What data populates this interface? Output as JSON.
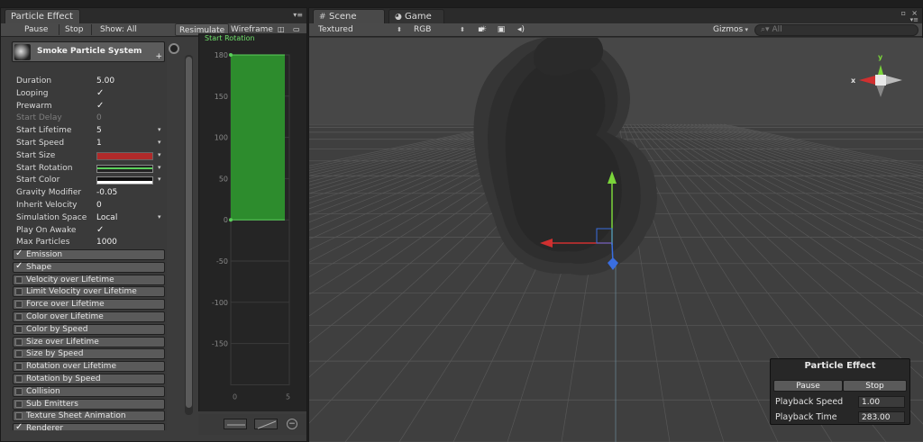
{
  "particle_window": {
    "tab": "Particle Effect",
    "toolbar": {
      "pause": "Pause",
      "stop": "Stop",
      "show": "Show: All",
      "resimulate": "Resimulate",
      "wireframe": "Wireframe"
    }
  },
  "inspector": {
    "system_name": "Smoke Particle System",
    "plus": "+",
    "props": [
      {
        "label": "Duration",
        "value": "5.00"
      },
      {
        "label": "Looping",
        "check": "✓"
      },
      {
        "label": "Prewarm",
        "check": "✓"
      },
      {
        "label": "Start Delay",
        "value": "0"
      },
      {
        "label": "Start Lifetime",
        "value": "5"
      },
      {
        "label": "Start Speed",
        "value": "1"
      },
      {
        "label": "Start Size"
      },
      {
        "label": "Start Rotation"
      },
      {
        "label": "Start Color"
      },
      {
        "label": "Gravity Modifier",
        "value": "-0.05"
      },
      {
        "label": "Inherit Velocity",
        "value": "0"
      },
      {
        "label": "Simulation Space",
        "value": "Local"
      },
      {
        "label": "Play On Awake",
        "check": "✓"
      },
      {
        "label": "Max Particles",
        "value": "1000"
      }
    ],
    "modules": [
      {
        "label": "Emission",
        "enabled": "✓"
      },
      {
        "label": "Shape",
        "enabled": "✓"
      },
      {
        "label": "Velocity over Lifetime"
      },
      {
        "label": "Limit Velocity over Lifetime"
      },
      {
        "label": "Force over Lifetime"
      },
      {
        "label": "Color over Lifetime"
      },
      {
        "label": "Color by Speed"
      },
      {
        "label": "Size over Lifetime"
      },
      {
        "label": "Size by Speed"
      },
      {
        "label": "Rotation over Lifetime"
      },
      {
        "label": "Rotation by Speed"
      },
      {
        "label": "Collision"
      },
      {
        "label": "Sub Emitters"
      },
      {
        "label": "Texture Sheet Animation"
      },
      {
        "label": "Renderer",
        "enabled": "✓"
      }
    ]
  },
  "curve_editor": {
    "title": "Start Rotation",
    "y_ticks": [
      "180",
      "150",
      "100",
      "50",
      "0",
      "-50",
      "-100",
      "-150"
    ],
    "x_ticks": [
      "0",
      "5"
    ],
    "curve_value_range": [
      0,
      180
    ]
  },
  "scene_window": {
    "tabs": [
      "Scene",
      "Game"
    ],
    "toolbar": {
      "render_mode": "Textured",
      "color_mode": "RGB",
      "gizmos": "Gizmos",
      "search_placeholder": "All"
    },
    "gizmo_labels": {
      "y": "y",
      "x": "x"
    }
  },
  "overlay": {
    "title": "Particle Effect",
    "pause": "Pause",
    "stop": "Stop",
    "playback_speed_label": "Playback Speed",
    "playback_speed": "1.00",
    "playback_time_label": "Playback Time",
    "playback_time": "283.00"
  },
  "colors": {
    "curve_green": "#2d8c2d",
    "curve_line": "#5bd15b",
    "size_red": "#b02a2a",
    "axis_x": "#d03030",
    "axis_y": "#7ad43a",
    "axis_z": "#3a6ee0"
  }
}
